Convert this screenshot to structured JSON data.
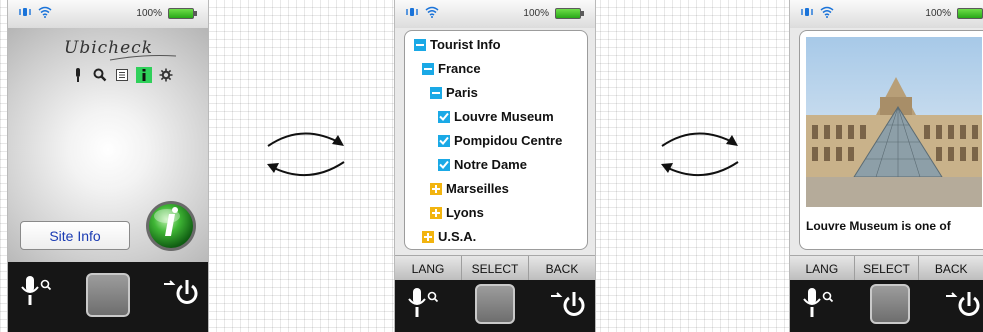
{
  "status": {
    "battery": "100%"
  },
  "screen1": {
    "logo": "Ubicheck",
    "tools": [
      {
        "icon": "mic-icon"
      },
      {
        "icon": "search-icon"
      },
      {
        "icon": "document-icon"
      },
      {
        "icon": "info-icon",
        "active": true
      },
      {
        "icon": "gear-icon"
      }
    ],
    "site_info_label": "Site Info"
  },
  "screen2": {
    "tree": [
      {
        "label": "Tourist Info",
        "state": "expanded"
      },
      {
        "label": "France",
        "state": "expanded"
      },
      {
        "label": "Paris",
        "state": "expanded"
      },
      {
        "label": "Louvre Museum",
        "state": "checked"
      },
      {
        "label": "Pompidou Centre",
        "state": "checked"
      },
      {
        "label": "Notre Dame",
        "state": "checked"
      },
      {
        "label": "Marseilles",
        "state": "collapsed"
      },
      {
        "label": "Lyons",
        "state": "collapsed"
      },
      {
        "label": "U.S.A.",
        "state": "collapsed"
      }
    ],
    "softkeys": [
      "LANG",
      "SELECT",
      "BACK"
    ]
  },
  "screen3": {
    "caption": "Louvre Museum is one of",
    "softkeys": [
      "LANG",
      "SELECT",
      "BACK"
    ]
  },
  "colors": {
    "accent_blue": "#1aa9e6",
    "plus_yellow": "#f2b40f",
    "active_green": "#2fd05a",
    "link_blue": "#1a3bb3"
  }
}
